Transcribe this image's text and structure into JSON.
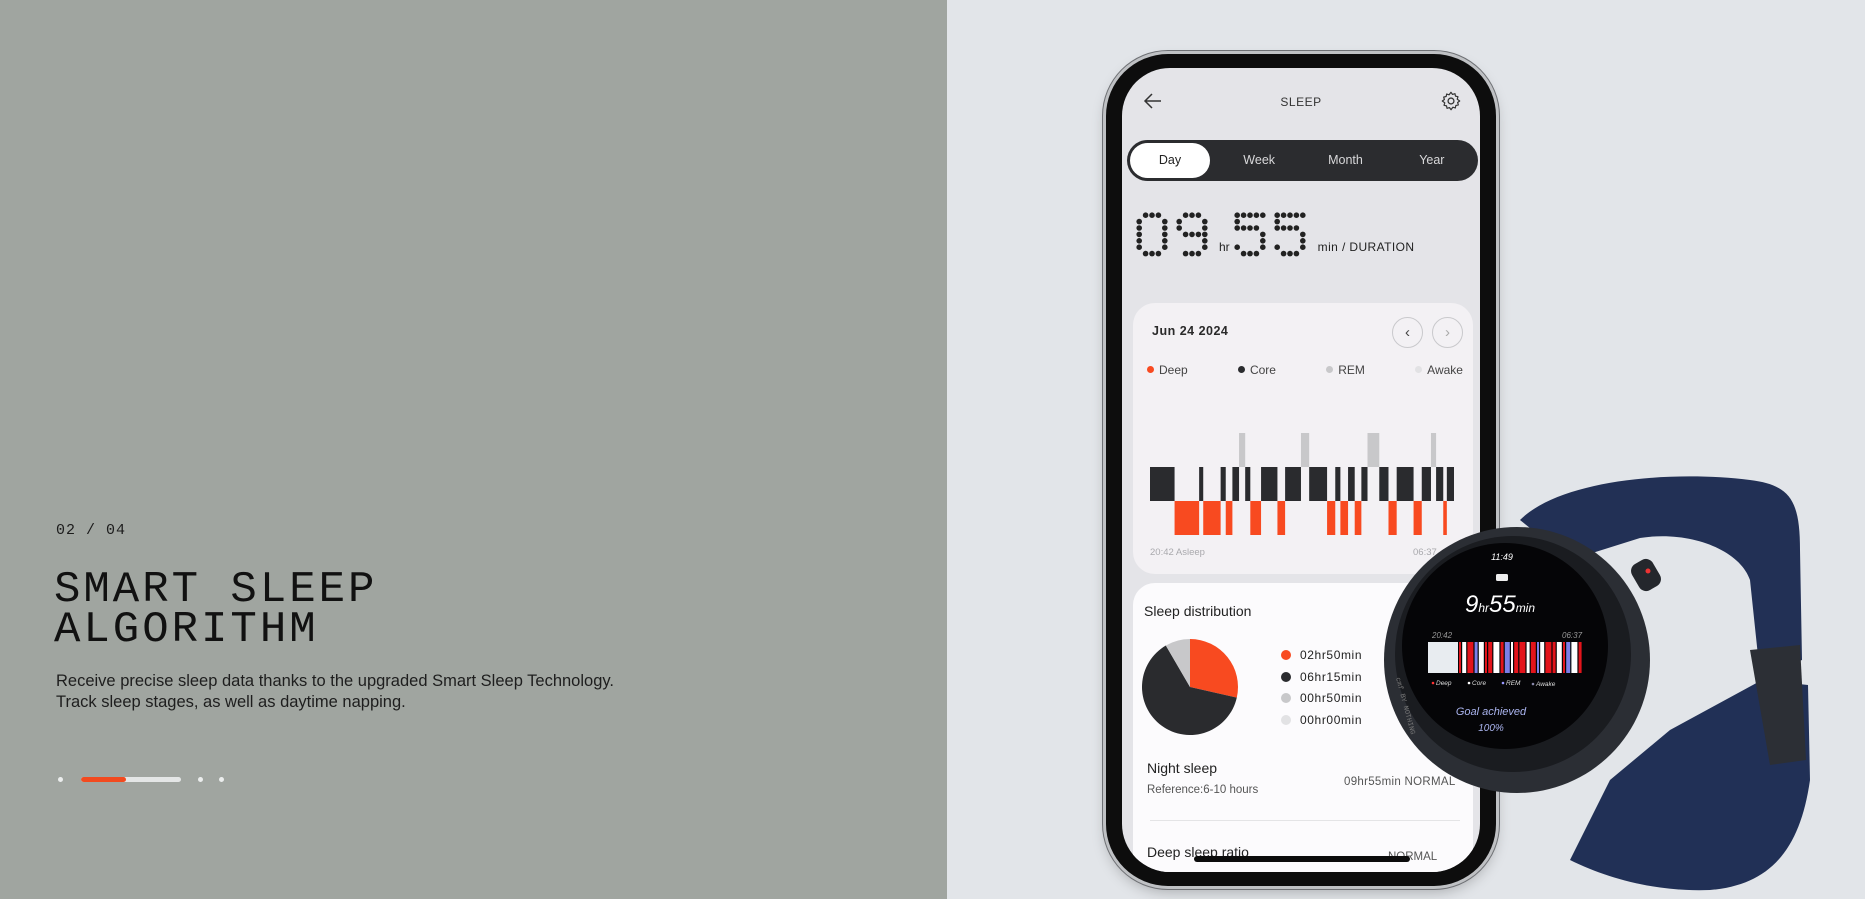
{
  "slide": {
    "counter": "02 / 04",
    "title_line1": "SMART SLEEP",
    "title_line2": "ALGORITHM",
    "desc_line1": "Receive precise sleep data thanks to the upgraded Smart Sleep Technology.",
    "desc_line2": "Track sleep stages, as well as daytime napping.",
    "pager": {
      "current": 2,
      "total": 4,
      "progress": 0.45,
      "accent": "#f24a1f"
    }
  },
  "app": {
    "title": "SLEEP",
    "back_icon": "arrow-left-icon",
    "settings_icon": "gear-icon",
    "tabs": [
      {
        "label": "Day",
        "active": true
      },
      {
        "label": "Week",
        "active": false
      },
      {
        "label": "Month",
        "active": false
      },
      {
        "label": "Year",
        "active": false
      }
    ],
    "duration": {
      "hours": "09",
      "hr_unit": "hr",
      "minutes": "55",
      "min_label": "min / DURATION"
    },
    "date": "Jun 24  2024",
    "prev_icon": "chevron-left-icon",
    "next_icon": "chevron-right-icon",
    "stages": [
      {
        "name": "Deep",
        "color": "#f84a20"
      },
      {
        "name": "Core",
        "color": "#2a2b2e"
      },
      {
        "name": "REM",
        "color": "#c8c8ca"
      },
      {
        "name": "Awake",
        "color": "#e2e2e4"
      }
    ],
    "chart_start": "20:42 Asleep",
    "chart_end": "06:37",
    "hypnogram_minutes": [
      [
        "Core",
        48
      ],
      [
        "Deep",
        48
      ],
      [
        "Core",
        8
      ],
      [
        "Deep",
        34
      ],
      [
        "Core",
        10
      ],
      [
        "Deep",
        13
      ],
      [
        "Core",
        13
      ],
      [
        "REM",
        12
      ],
      [
        "Core",
        10
      ],
      [
        "Deep",
        21
      ],
      [
        "Core",
        32
      ],
      [
        "Deep",
        15
      ],
      [
        "Core",
        31
      ],
      [
        "REM",
        16
      ],
      [
        "Core",
        35
      ],
      [
        "Deep",
        16
      ],
      [
        "Core",
        10
      ],
      [
        "Deep",
        15
      ],
      [
        "Core",
        13
      ],
      [
        "Deep",
        13
      ],
      [
        "Core",
        12
      ],
      [
        "REM",
        23
      ],
      [
        "Core",
        18
      ],
      [
        "Deep",
        16
      ],
      [
        "Core",
        33
      ],
      [
        "Deep",
        16
      ],
      [
        "Core",
        18
      ],
      [
        "REM",
        10
      ],
      [
        "Core",
        14
      ],
      [
        "Deep",
        7
      ],
      [
        "Core",
        14
      ]
    ],
    "distribution": {
      "title": "Sleep distribution",
      "items": [
        {
          "stage": "Deep",
          "label": "02hr50min",
          "minutes": 170
        },
        {
          "stage": "Core",
          "label": "06hr15min",
          "minutes": 375
        },
        {
          "stage": "REM",
          "label": "00hr50min",
          "minutes": 50
        },
        {
          "stage": "Awake",
          "label": "00hr00min",
          "minutes": 0
        }
      ]
    },
    "night_sleep": {
      "title": "Night sleep",
      "reference": "Reference:6-10 hours",
      "value": "09hr55min NORMAL"
    },
    "deep_ratio": {
      "title": "Deep sleep ratio",
      "value": "NORMAL"
    }
  },
  "watch": {
    "time": "11:49",
    "bed_icon": "bed-icon",
    "hours": "9",
    "hr": "hr",
    "minutes": "55",
    "min": "min",
    "start": "20:42",
    "end": "06:37",
    "legend": [
      "Deep",
      "Core",
      "REM",
      "Awake"
    ],
    "goal": "Goal achieved",
    "goal_pct": "100%",
    "brand": "cmf BY NOTHING",
    "strap_color": "#223055"
  }
}
